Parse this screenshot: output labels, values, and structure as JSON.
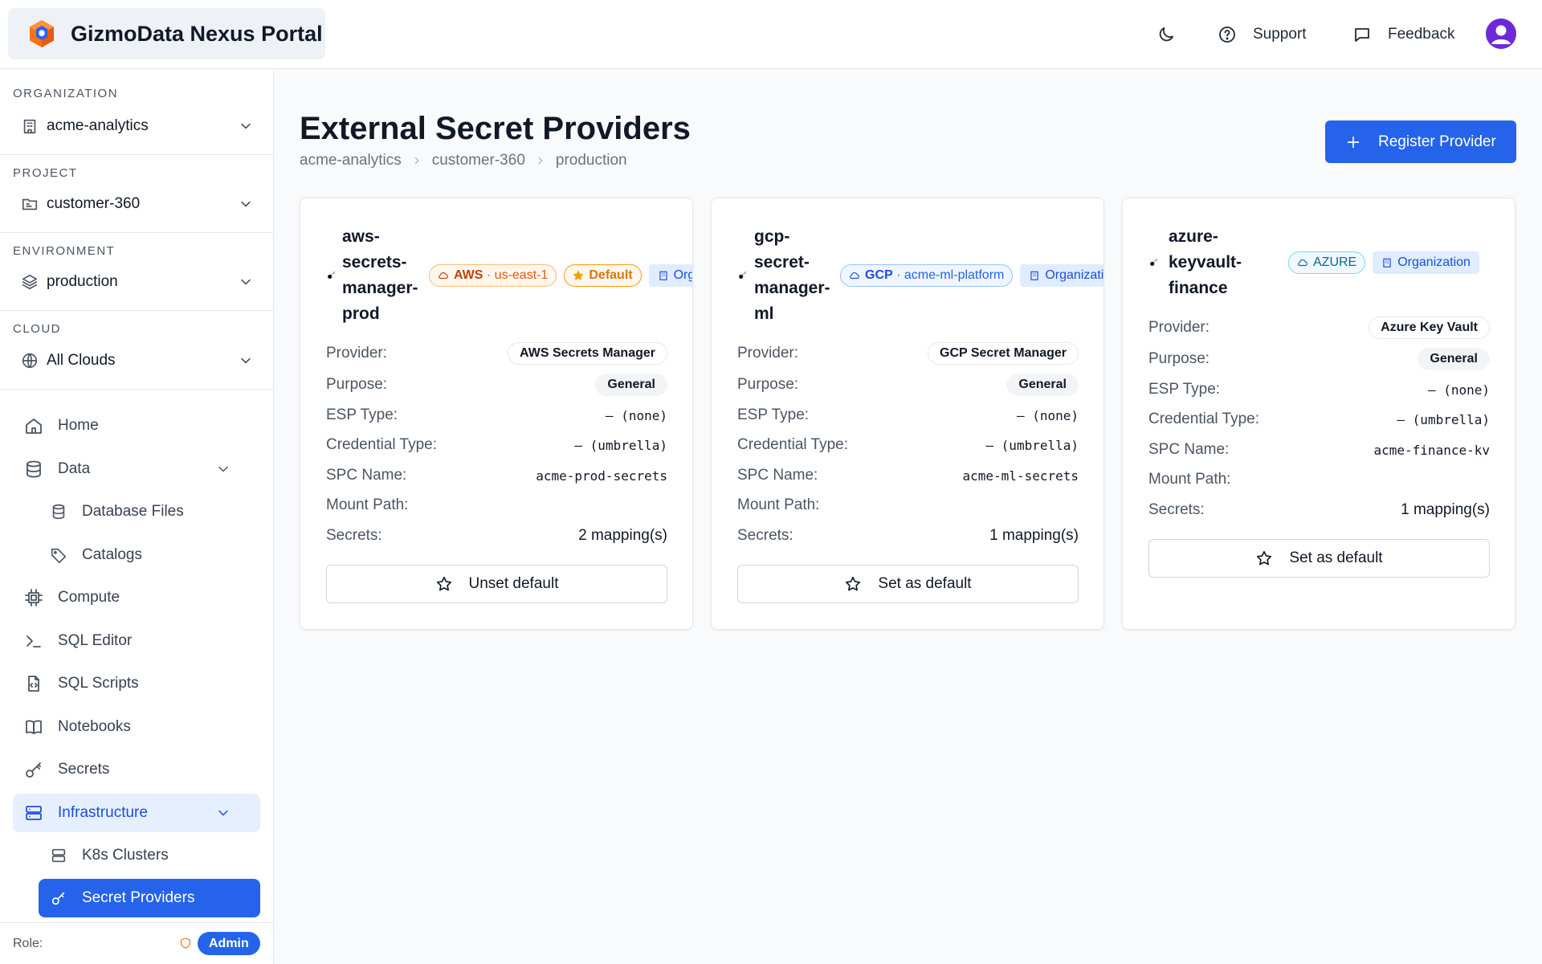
{
  "header": {
    "app_title": "GizmoData Nexus Portal",
    "support_label": "Support",
    "feedback_label": "Feedback"
  },
  "sidebar": {
    "organization": {
      "label": "ORGANIZATION",
      "value": "acme-analytics"
    },
    "project": {
      "label": "PROJECT",
      "value": "customer-360"
    },
    "environment": {
      "label": "ENVIRONMENT",
      "value": "production"
    },
    "cloud": {
      "label": "CLOUD",
      "value": "All Clouds"
    },
    "nav": {
      "home": "Home",
      "data": "Data",
      "database_files": "Database Files",
      "catalogs": "Catalogs",
      "compute": "Compute",
      "sql_editor": "SQL Editor",
      "sql_scripts": "SQL Scripts",
      "notebooks": "Notebooks",
      "secrets": "Secrets",
      "infrastructure": "Infrastructure",
      "k8s_clusters": "K8s Clusters",
      "secret_providers": "Secret Providers"
    },
    "role": {
      "label": "Role:",
      "value": "Admin"
    }
  },
  "main": {
    "title": "External Secret Providers",
    "breadcrumb": [
      "acme-analytics",
      "customer-360",
      "production"
    ],
    "register_button": "Register Provider",
    "field_labels": {
      "provider": "Provider:",
      "purpose": "Purpose:",
      "esp_type": "ESP Type:",
      "credential_type": "Credential Type:",
      "spc_name": "SPC Name:",
      "mount_path": "Mount Path:",
      "secrets": "Secrets:"
    },
    "cards": [
      {
        "name_lines": [
          "aws-",
          "secrets-",
          "manager-",
          "prod"
        ],
        "cloud": "AWS",
        "region": "· us-east-1",
        "default_badge": "Default",
        "scope": "Organization",
        "provider": "AWS Secrets Manager",
        "purpose": "General",
        "esp_type": "— (none)",
        "credential_type": "— (umbrella)",
        "spc_name": "acme-prod-secrets",
        "mount_path": "",
        "secrets": "2 mapping(s)",
        "action": "Unset default"
      },
      {
        "name_lines": [
          "gcp-",
          "secret-",
          "manager-",
          "ml"
        ],
        "cloud": "GCP",
        "region": "· acme-ml-platform",
        "scope": "Organization",
        "provider": "GCP Secret Manager",
        "purpose": "General",
        "esp_type": "— (none)",
        "credential_type": "— (umbrella)",
        "spc_name": "acme-ml-secrets",
        "mount_path": "",
        "secrets": "1 mapping(s)",
        "action": "Set as default"
      },
      {
        "name_lines": [
          "azure-",
          "keyvault-",
          "finance"
        ],
        "cloud": "AZURE",
        "scope": "Organization",
        "provider": "Azure Key Vault",
        "purpose": "General",
        "esp_type": "— (none)",
        "credential_type": "— (umbrella)",
        "spc_name": "acme-finance-kv",
        "mount_path": "",
        "secrets": "1 mapping(s)",
        "action": "Set as default"
      }
    ]
  },
  "colors": {
    "accent": "#2563eb",
    "aws_orange": "#c2410c",
    "default_amber": "#f59e0b",
    "gcp_blue": "#1d4ed8",
    "azure_blue": "#0369a1"
  },
  "icons": [
    "moon-icon",
    "help-circle-icon",
    "message-square-icon",
    "user-icon",
    "building-icon",
    "folder-icon",
    "layers-icon",
    "globe-icon",
    "home-icon",
    "database-icon",
    "tag-icon",
    "cpu-icon",
    "terminal-icon",
    "file-code-icon",
    "book-icon",
    "key-icon",
    "server-icon",
    "shield-icon",
    "plus-icon",
    "cloud-icon",
    "star-icon",
    "chevron-down-icon",
    "chevron-right-icon"
  ]
}
